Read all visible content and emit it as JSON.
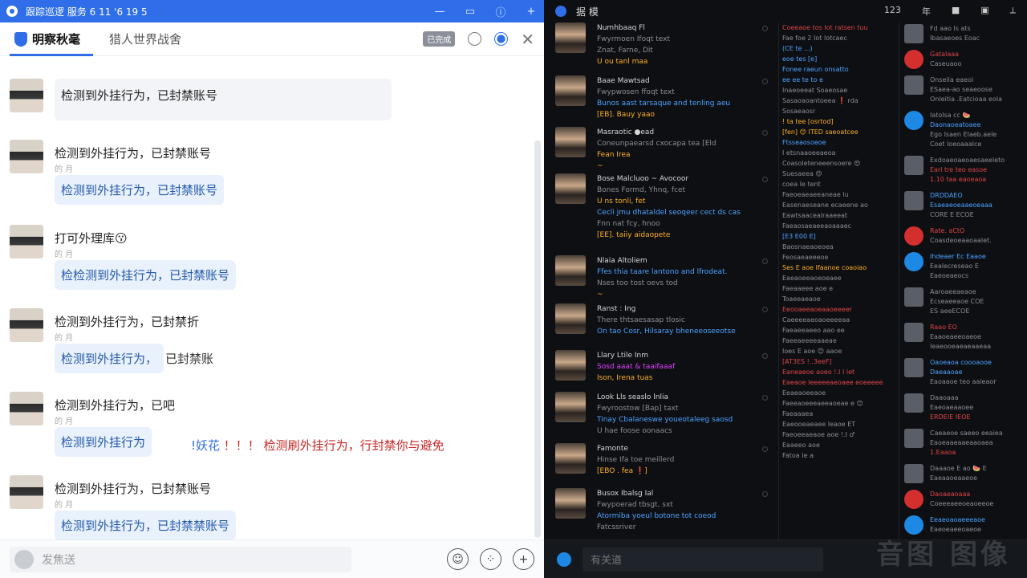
{
  "left": {
    "window_title": "跟踪巡逻 服务 6 11 '6 19   5",
    "tabs": [
      {
        "label": "明察秋毫"
      },
      {
        "label": "猎人世界战舍"
      }
    ],
    "toolbar_badge": "已完成",
    "messages": [
      {
        "text": "",
        "sub": "",
        "bubble": "检测到外挂行为，已封禁账号",
        "after": ""
      },
      {
        "text": "检测到外挂行为，已封禁账号",
        "sub": "的 月",
        "bubble": "检测到外挂行为，已封禁账号",
        "after": ""
      },
      {
        "text": "打可外理库😗",
        "sub": "的 月",
        "bubble": "检检测到外挂行为，已封禁账号",
        "after": ""
      },
      {
        "text": "检测到外挂行为，已封禁折",
        "sub": "的 月",
        "bubble": "检测到外挂行为，",
        "after": "已封禁账"
      },
      {
        "text": "检测到外挂行为，已吧",
        "sub": "的 月",
        "bubble": "检测到外挂行为",
        "after": ""
      },
      {
        "text": "检测到外挂行为，已封禁账号",
        "sub": "的 月",
        "bubble": "检测到外挂行为，已封禁禁账号",
        "after": ""
      }
    ],
    "red_notice_lead": "!妖花",
    "red_notice": "！！！ 检测刷外挂行为，行封禁你与避免",
    "input_placeholder": "发焦送"
  },
  "right": {
    "window_title": "据 模",
    "title_meta": [
      "123",
      "年"
    ],
    "feed": [
      {
        "name": "Numhbaaq Fl",
        "lines": [
          [
            "Fwyrmoen Ifoqt text",
            "g"
          ],
          [
            "Znat, Farne, Dit",
            "g"
          ],
          [
            "U ou tanl maa",
            "o"
          ]
        ]
      },
      {
        "name": "Baae Mawtsad",
        "lines": [
          [
            "Fwypwosen ffoqt text",
            "g"
          ],
          [
            "Bunos aast tarsaque and tenling aeu",
            "b"
          ],
          [
            "[EB]. Bauy yaao",
            "o"
          ]
        ]
      },
      {
        "name": "Masraotic ●ead",
        "lines": [
          [
            "Coneunpaearsd cxocapa tea [Eld",
            "g"
          ],
          [
            "Fean Irea",
            "o"
          ],
          [
            "~",
            "o"
          ]
        ]
      },
      {
        "name": "Bose Malcluoo ~ Avocoor",
        "lines": [
          [
            "Bones Formd, Yhnq, fcet",
            "g"
          ],
          [
            "U ns tonli, fet",
            "o"
          ],
          [
            "Cecli jmu dhataldel seoqeer cect ds cas",
            "b"
          ],
          [
            "Fnn nat fcy, hnoo",
            "g"
          ],
          [
            "[EE]. taiiy aidaopete",
            "o"
          ]
        ]
      },
      {
        "name": "Nlaia Altoliem",
        "lines": [
          [
            "Ffes thia taare lantono and lfrodeat.",
            "b"
          ],
          [
            "Nses too tost oevs tod",
            "g"
          ],
          [
            "~",
            "o"
          ]
        ]
      },
      {
        "name": "Ranst : Ing",
        "lines": [
          [
            "There thtsaesasap tlosic",
            "g"
          ],
          [
            "On tao Cosr, Hilsaray bheneeoseeotse",
            "b"
          ]
        ]
      },
      {
        "name": "Llary Ltile Inm",
        "lines": [
          [
            "Sosd aaat & taaifaaaf",
            "m"
          ],
          [
            "Ison, Irena tuas",
            "o"
          ]
        ]
      },
      {
        "name": "Look Lls seaslo lnlia",
        "lines": [
          [
            "Fwyroostow [Bap] taxt",
            "g"
          ],
          [
            "Tinay Cbalaneswe youeotaleeg saosd",
            "b"
          ],
          [
            "U hae foose oonaacs",
            "g"
          ]
        ]
      },
      {
        "name": "Famonte",
        "lines": [
          [
            "Hinse Ifa toe meillerd",
            "g"
          ],
          [
            "[EBO . fea ❗]",
            "o"
          ]
        ]
      },
      {
        "name": "Busox Ibalsg Ial",
        "lines": [
          [
            "Fwypoerad tbsgt, sxt",
            "g"
          ],
          [
            "Atormiba yoeul botone tot coeod",
            "b"
          ],
          [
            "Fatcssriver",
            "g"
          ]
        ]
      }
    ],
    "mid_lines": [
      [
        "Coeeaoe tos Iot ratsen tuu",
        "r"
      ],
      [
        "Fae foe 2 Iot lotcaec",
        "g"
      ],
      [
        "(CE te ...)",
        "b"
      ],
      [
        "eoe tes [e]",
        "b"
      ],
      [
        "Fonee raeun onsatto",
        "b"
      ],
      [
        "ee ee te to e",
        "b"
      ],
      [
        "Inaeoeeat Soaeosae",
        "g"
      ],
      [
        "Sasaoaoantoeea ❗ rda",
        "g"
      ],
      [
        "Sosaeaosr",
        "g"
      ],
      [
        "! ta tee [osrtod]",
        "o"
      ],
      [
        "[fen] 😊 ITED saeoatcee",
        "o"
      ],
      [
        "Ftsseaosoeoe",
        "b"
      ],
      [
        "I etsnaaoeeaeoa",
        "g"
      ],
      [
        "Coasoleteneeensoere 😍",
        "g"
      ],
      [
        "Suesaeea 😍",
        "g"
      ],
      [
        "coea Ie tent",
        "g"
      ],
      [
        "Faeoeaeaeeaneae lu",
        "g"
      ],
      [
        "Easenaeseane ecaeene ao",
        "g"
      ],
      [
        "Eawtsaacealraaeeat",
        "g"
      ],
      [
        "Faeaosaeaeeaoaaaec",
        "g"
      ],
      [
        "[E3 E00 E]",
        "b"
      ],
      [
        "Baosnaeaoeoea",
        "g"
      ],
      [
        "Feosaeaeeeoe",
        "g"
      ],
      [
        "Ses E aoe Ifaanoe coaoiao",
        "o"
      ],
      [
        "Eaeaoeeaoeoeaee",
        "g"
      ],
      [
        "Faeaaeee aoe e",
        "g"
      ],
      [
        "Toaeeaeaoe",
        "g"
      ],
      [
        "Eeooaeeaoeaaoeeeer",
        "r"
      ],
      [
        "Caeeeeaeoaoeeeeaa",
        "g"
      ],
      [
        "Faeaeeaeeo aao ee",
        "g"
      ],
      [
        "Faeeaeeeeaaeae",
        "g"
      ],
      [
        "Ioes E aoe 😊 aaoe",
        "g"
      ],
      [
        "[AT3ES !..3eeF]",
        "r"
      ],
      [
        "Eaneaeoe aoeo !.I I let",
        "r"
      ],
      [
        "Eaeaoe Ieeeeeaeoaee eoeeeee",
        "r"
      ],
      [
        "Eeaeaoeeaoe",
        "g"
      ],
      [
        "Faeeaoeeeaeeaoeae e 😊",
        "g"
      ],
      [
        "Faeaaaea",
        "g"
      ],
      [
        "Eaeooeaeaee Ieaoe ET",
        "g"
      ],
      [
        "Faeoeeaeaoe aoe !.I ♂",
        "g"
      ],
      [
        "Eaaeeo aoe",
        "g"
      ],
      [
        "Fatoa Ie a",
        "g"
      ]
    ],
    "side": [
      {
        "t": "g",
        "lines": [
          [
            "Fd aao ls ats",
            "g"
          ],
          [
            "Ibasaeoes Eoac",
            "g"
          ]
        ]
      },
      {
        "t": "red",
        "lines": [
          [
            "Gatalaaa",
            "r"
          ],
          [
            "Caseuaoo",
            "g"
          ]
        ]
      },
      {
        "t": "g",
        "lines": [
          [
            "Onseila eaeoi",
            "g"
          ],
          [
            "ESaea-ao seaeoose",
            "g"
          ],
          [
            "Onleitia .Eatcioaa eola",
            "g"
          ]
        ]
      },
      {
        "t": "blue",
        "lines": [
          [
            "Iatolsa cc 🍉",
            "g"
          ],
          [
            "Daonaoeatoaee",
            "b"
          ],
          [
            "Ego Isaen Elaeb.aele",
            "g"
          ],
          [
            "Coet loeoaaalce",
            "g"
          ]
        ]
      },
      {
        "t": "g",
        "lines": [
          [
            "Exdoaeoaeoaesaeeleto",
            "g"
          ],
          [
            "Earl tre teo easoe",
            "r"
          ],
          [
            "1.10 taa eaoeaoa",
            "r"
          ]
        ]
      },
      {
        "t": "g",
        "lines": [
          [
            "DRDDAEO",
            "b"
          ],
          [
            "Esaeaeoeaaeoeaaa",
            "b"
          ],
          [
            "CORE E ECOE",
            "g"
          ]
        ]
      },
      {
        "t": "red",
        "lines": [
          [
            "Rate. aCtO",
            "r"
          ],
          [
            "Coasdeoeaaoaalet.",
            "g"
          ]
        ]
      },
      {
        "t": "blue",
        "lines": [
          [
            "Ihdeaer Ec Eaaoe",
            "b"
          ],
          [
            "Eealecreseao E",
            "g"
          ],
          [
            "Eaeoeaeocs",
            "g"
          ]
        ]
      },
      {
        "t": "g",
        "lines": [
          [
            "Aaroaeeaeaoe",
            "g"
          ],
          [
            "Ecseaeeaoe COE",
            "g"
          ],
          [
            "ES aeeECOE",
            "g"
          ]
        ]
      },
      {
        "t": "g",
        "lines": [
          [
            "Raao EO",
            "r"
          ],
          [
            "Eaaoeaeeoaeoe",
            "g"
          ],
          [
            "Ieaeooeaeaeaaeaa",
            "g"
          ]
        ]
      },
      {
        "t": "g",
        "lines": [
          [
            "Oaoeaoa coooaooe",
            "b"
          ],
          [
            "Daeaaoae",
            "b"
          ],
          [
            "Eaoaaoe teo aaieaor",
            "g"
          ]
        ]
      },
      {
        "t": "g",
        "lines": [
          [
            "Daaoaaa",
            "g"
          ],
          [
            "Eaeoaeaaoee",
            "g"
          ],
          [
            "ERDEIE IEOE",
            "r"
          ]
        ]
      },
      {
        "t": "g",
        "lines": [
          [
            "Caeaeoe saeeo eeaiea",
            "g"
          ],
          [
            "Eaoeaaeaaeaaoaea",
            "g"
          ],
          [
            "1.Eaaoa",
            "r"
          ]
        ]
      },
      {
        "t": "g",
        "lines": [
          [
            "Daaaoe E ao 🍉 E",
            "g"
          ],
          [
            "Eaeaaoeaaeoe",
            "g"
          ]
        ]
      },
      {
        "t": "red",
        "lines": [
          [
            "Daoaeaoaaa",
            "r"
          ],
          [
            "Coeeeaeeoeaoeeoe",
            "g"
          ]
        ]
      },
      {
        "t": "blue",
        "lines": [
          [
            "Eeaeoaoaeeeaoe",
            "b"
          ],
          [
            "Eaeoeaeeoaeoe",
            "g"
          ]
        ]
      }
    ],
    "input_placeholder": "有关道",
    "watermark": "音图 图像"
  },
  "colors": {
    "accent": "#2f6ee8",
    "dark_bg": "#0d0f13",
    "alert_red": "#c62828"
  }
}
